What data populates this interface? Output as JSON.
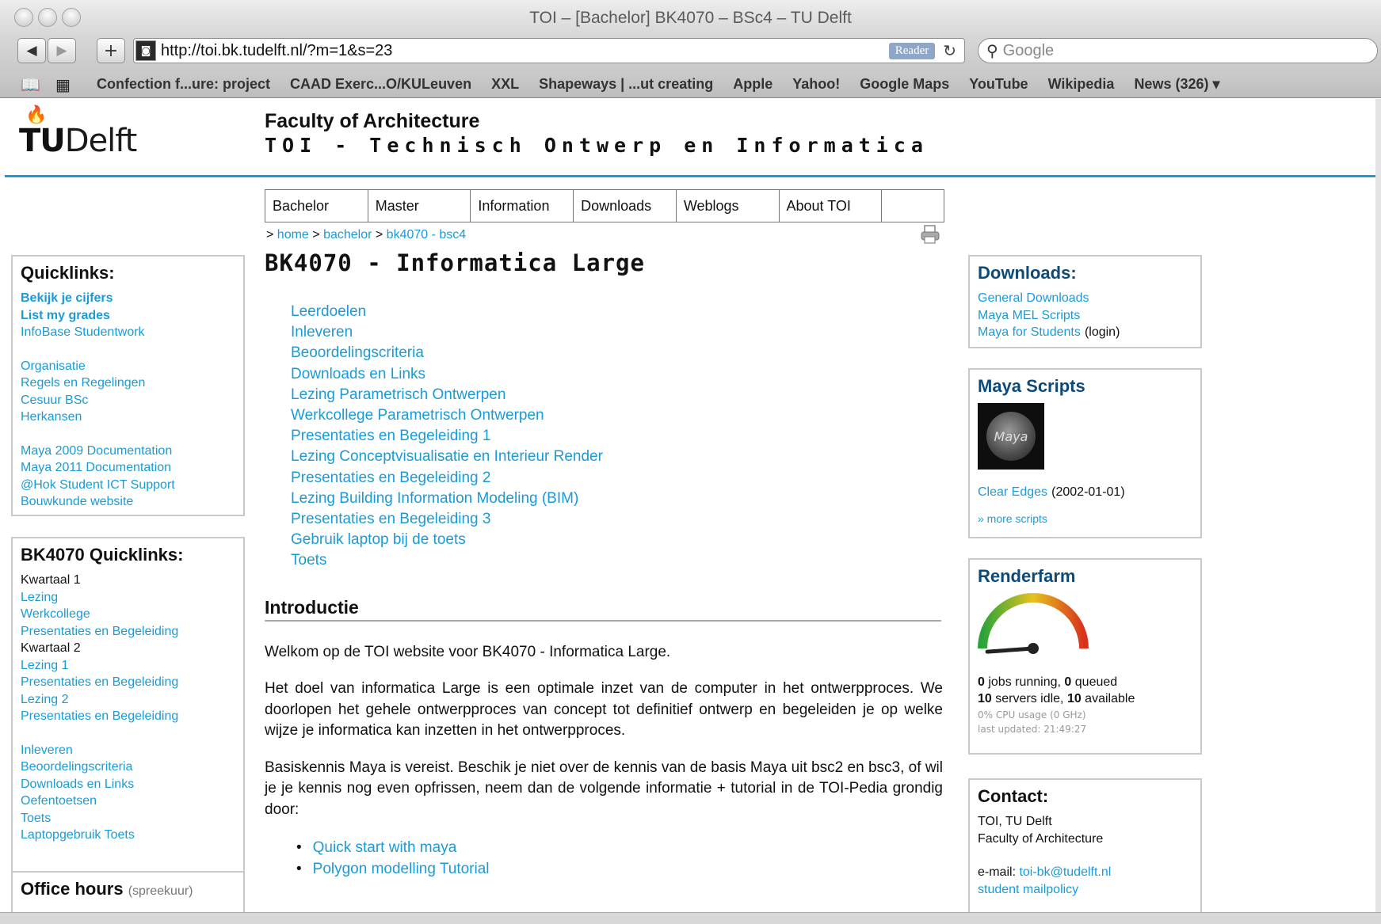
{
  "browser": {
    "window_title": "TOI – [Bachelor] BK4070 – BSc4 – TU Delft",
    "url": "http://toi.bk.tudelft.nl/?m=1&s=23",
    "reader_label": "Reader",
    "search_placeholder": "Google",
    "bookmarks": [
      "Confection f...ure: project",
      "CAAD Exerc...O/KULeuven",
      "XXL",
      "Shapeways | ...ut creating",
      "Apple",
      "Yahoo!",
      "Google Maps",
      "YouTube",
      "Wikipedia",
      "News (326) ▾"
    ]
  },
  "header": {
    "logo_tu": "TU",
    "logo_delft": "Delft",
    "faculty": "Faculty of Architecture",
    "subtitle": "TOI - Technisch Ontwerp en Informatica"
  },
  "nav": {
    "tabs": [
      "Bachelor",
      "Master",
      "Information",
      "Downloads",
      "Weblogs",
      "About TOI"
    ]
  },
  "breadcrumb": {
    "prefix": "> ",
    "home": "home",
    "sep1": " > ",
    "bachelor": "bachelor",
    "sep2": " > ",
    "current": "bk4070 - bsc4"
  },
  "quicklinks": {
    "title": "Quicklinks:",
    "group1": [
      "Bekijk je cijfers",
      "List my grades",
      "InfoBase Studentwork"
    ],
    "group2": [
      "Organisatie",
      "Regels en Regelingen",
      "Cesuur BSc",
      "Herkansen"
    ],
    "group3": [
      "Maya 2009 Documentation",
      "Maya 2011 Documentation",
      "@Hok Student ICT Support",
      "Bouwkunde website"
    ]
  },
  "bk_quicklinks": {
    "title": "BK4070 Quicklinks:",
    "kwartaal1": "Kwartaal 1",
    "k1_links": [
      "Lezing",
      "Werkcollege",
      "Presentaties en Begeleiding"
    ],
    "kwartaal2": "Kwartaal 2",
    "k2_links": [
      "Lezing 1",
      "Presentaties en Begeleiding",
      "Lezing 2",
      "Presentaties en Begeleiding"
    ],
    "other_links": [
      "Inleveren",
      "Beoordelingscriteria",
      "Downloads en Links",
      "Oefentoetsen",
      "Toets",
      "Laptopgebruik Toets"
    ]
  },
  "office_hours": {
    "title": "Office hours",
    "subtitle": "(spreekuur)"
  },
  "main": {
    "heading": "BK4070 - Informatica Large",
    "toc": [
      "Leerdoelen",
      "Inleveren",
      "Beoordelingscriteria",
      "Downloads en Links",
      "Lezing Parametrisch Ontwerpen",
      "Werkcollege Parametrisch Ontwerpen",
      "Presentaties en Begeleiding 1",
      "Lezing Conceptvisualisatie en Interieur Render",
      "Presentaties en Begeleiding 2",
      "Lezing Building Information Modeling (BIM)",
      "Presentaties en Begeleiding 3",
      "Gebruik laptop bij de toets",
      "Toets"
    ],
    "intro_heading": "Introductie",
    "para1": "Welkom op de TOI website voor BK4070 - Informatica Large.",
    "para2": "Het doel van informatica Large is een optimale inzet van de computer in het ontwerpproces. We doorlopen het gehele ontwerpproces van concept tot definitief ontwerp en begeleiden je op welke wijze je informatica kan inzetten in het ontwerpproces.",
    "para3": "Basiskennis Maya is vereist. Beschik je niet over de kennis van de basis Maya uit bsc2 en bsc3, of wil je je kennis nog even opfrissen, neem dan de volgende informatie + tutorial in de TOI-Pedia grondig door:",
    "tutorials": [
      "Quick start with maya",
      "Polygon modelling Tutorial"
    ]
  },
  "downloads": {
    "title": "Downloads:",
    "links": [
      "General Downloads",
      "Maya MEL Scripts",
      "Maya for Students"
    ],
    "login_note": "(login)"
  },
  "maya_scripts": {
    "title": "Maya Scripts",
    "thumb_label": "Maya",
    "script_name": "Clear Edges",
    "script_date": "(2002-01-01)",
    "more": "» more scripts"
  },
  "renderfarm": {
    "title": "Renderfarm",
    "gauge_level": 0.0,
    "jobs_running": "0",
    "jobs_running_text": " jobs running, ",
    "queued": "0",
    "queued_text": " queued",
    "servers_idle": "10",
    "servers_idle_text": " servers idle, ",
    "available": "10",
    "available_text": " available",
    "cpu_usage": "0% CPU usage (0 GHz)",
    "last_updated": "last updated: 21:49:27"
  },
  "contact": {
    "title": "Contact:",
    "line1": "TOI, TU Delft",
    "line2": "Faculty of Architecture",
    "email_label": "e-mail: ",
    "email": "toi-bk@tudelft.nl",
    "mailpolicy": "student mailpolicy"
  },
  "colors": {
    "accent": "#1a9bd7",
    "dark_blue": "#0d4a78"
  }
}
